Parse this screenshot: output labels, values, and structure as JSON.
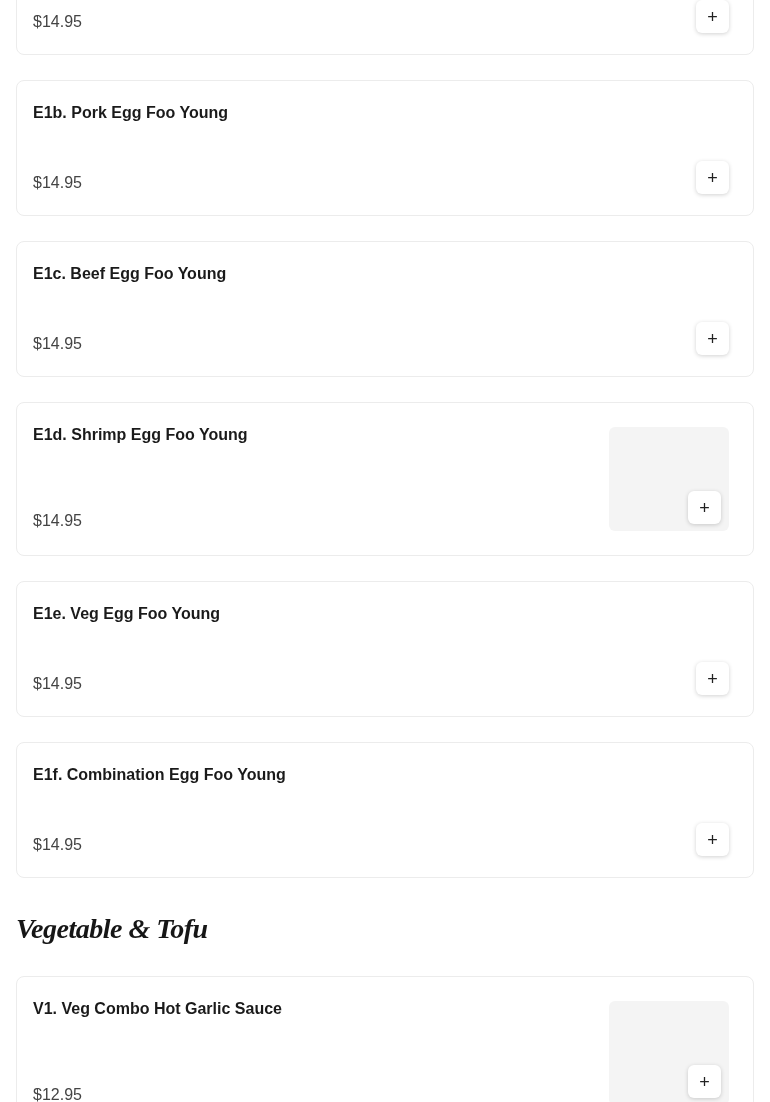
{
  "sections": [
    {
      "items": [
        {
          "price": "$14.95",
          "add_label": "+",
          "image": false
        }
      ]
    },
    {
      "items": [
        {
          "name": "E1b. Pork Egg Foo Young",
          "price": "$14.95",
          "add_label": "+",
          "image": false
        },
        {
          "name": "E1c. Beef Egg Foo Young",
          "price": "$14.95",
          "add_label": "+",
          "image": false
        },
        {
          "name": "E1d. Shrimp Egg Foo Young",
          "price": "$14.95",
          "add_label": "+",
          "image": true
        },
        {
          "name": "E1e. Veg Egg Foo Young",
          "price": "$14.95",
          "add_label": "+",
          "image": false
        },
        {
          "name": "E1f. Combination Egg Foo Young",
          "price": "$14.95",
          "add_label": "+",
          "image": false
        }
      ]
    },
    {
      "title": "Vegetable & Tofu",
      "items": [
        {
          "name": "V1. Veg Combo Hot Garlic Sauce",
          "price": "$12.95",
          "add_label": "+",
          "image": true
        }
      ]
    }
  ]
}
